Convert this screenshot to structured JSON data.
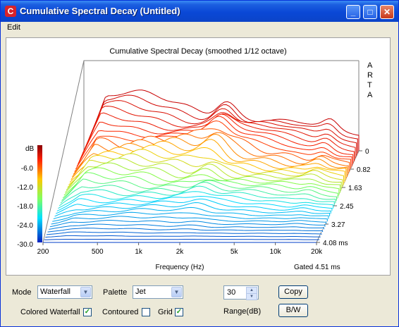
{
  "window": {
    "title": "Cumulative Spectral Decay  (Untitled)",
    "icon": "arta-app-icon",
    "controls": [
      "minimize",
      "maximize",
      "close"
    ]
  },
  "menu": {
    "edit_label": "Edit"
  },
  "plot": {
    "title": "Cumulative Spectral Decay (smoothed 1/12 octave)",
    "brand_letters": [
      "A",
      "R",
      "T",
      "A"
    ],
    "db_label": "dB",
    "db_ticks": [
      "-6.0",
      "-12.0",
      "-18.0",
      "-24.0",
      "-30.0"
    ],
    "freq_ticks": [
      "200",
      "500",
      "1k",
      "2k",
      "5k",
      "10k",
      "20k"
    ],
    "x_label": "Frequency (Hz)",
    "time_ticks": [
      "0",
      "0.82",
      "1.63",
      "2.45",
      "3.27",
      "4.08 ms"
    ],
    "gated_label": "Gated 4.51 ms",
    "palette_colors": [
      "#ff0000",
      "#ffff00",
      "#00ffff",
      "#0000ff"
    ]
  },
  "controls": {
    "mode_label": "Mode",
    "mode_value": "Waterfall",
    "palette_label": "Palette",
    "palette_value": "Jet",
    "range_value": "30",
    "range_label": "Range(dB)",
    "copy_label": "Copy",
    "bw_label": "B/W",
    "colored_waterfall_label": "Colored Waterfall",
    "colored_waterfall_checked": true,
    "contoured_label": "Contoured",
    "contoured_checked": false,
    "grid_label": "Grid",
    "grid_checked": true
  }
}
